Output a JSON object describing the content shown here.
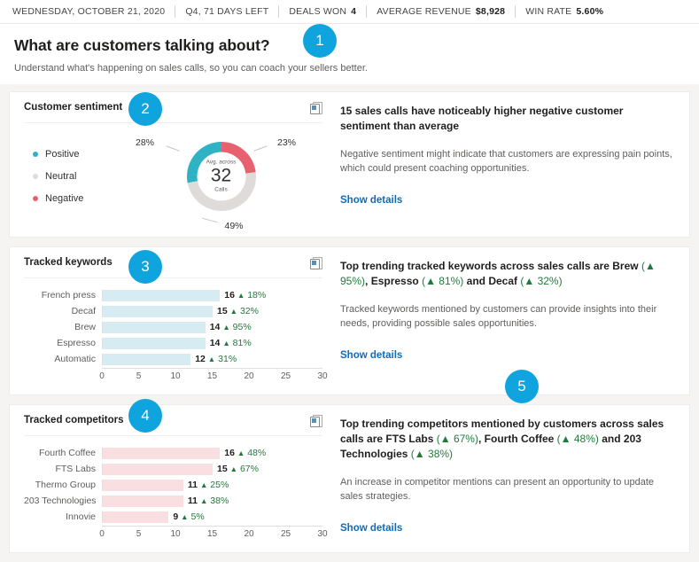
{
  "status_bar": {
    "items": [
      {
        "label": "WEDNESDAY, OCTOBER 21, 2020",
        "value": ""
      },
      {
        "label": "Q4, 71 DAYS LEFT",
        "value": ""
      },
      {
        "label": "DEALS WON",
        "value": "4"
      },
      {
        "label": "AVERAGE REVENUE",
        "value": "$8,928"
      },
      {
        "label": "WIN RATE",
        "value": "5.60%"
      }
    ]
  },
  "page": {
    "title": "What are customers talking about?",
    "subtitle": "Understand what's happening on sales calls, so you can coach your sellers better."
  },
  "colors": {
    "positive": "#2fb3c4",
    "neutral": "#dedbd9",
    "negative": "#e8616e",
    "keyword_bar": "#d7ecf2",
    "competitor_bar": "#fadfe2",
    "callout": "#0fa4de",
    "link": "#0f6cbd",
    "trend_up": "#217a3c"
  },
  "callouts": [
    {
      "number": "1"
    },
    {
      "number": "2"
    },
    {
      "number": "3"
    },
    {
      "number": "4"
    },
    {
      "number": "5"
    }
  ],
  "sentiment_card": {
    "title": "Customer sentiment",
    "copy_icon": "copy-icon",
    "legend": [
      {
        "label": "Positive",
        "color": "#2fb3c4"
      },
      {
        "label": "Neutral",
        "color": "#dedbd9"
      },
      {
        "label": "Negative",
        "color": "#e8616e"
      }
    ],
    "center_caption": "Avg. across",
    "center_value": "32",
    "center_unit": "Calls",
    "label_left": "28%",
    "label_right": "23%",
    "label_bottom": "49%",
    "insight_title_pre": "15 sales calls have noticeably higher negative customer sentiment than average",
    "insight_body": "Negative sentiment might indicate that customers are expressing pain points, which could present coaching opportunities.",
    "show_details": "Show details"
  },
  "keywords_card": {
    "title": "Tracked keywords",
    "copy_icon": "copy-icon",
    "insight_title_plain_1": "Top trending tracked keywords across sales calls are ",
    "insight_kw_1": "Brew",
    "insight_kw_1_pct": "95%",
    "insight_plain_2": ", ",
    "insight_kw_2": "Espresso",
    "insight_kw_2_pct": "81%",
    "insight_plain_3": " and ",
    "insight_kw_3": "Decaf",
    "insight_kw_3_pct": "32%",
    "insight_body": "Tracked keywords mentioned by customers can provide insights into their needs, providing possible sales opportunities.",
    "show_details": "Show details"
  },
  "competitors_card": {
    "title": "Tracked competitors",
    "copy_icon": "copy-icon",
    "insight_title_plain_1": "Top trending competitors mentioned by customers across sales calls are ",
    "insight_kw_1": "FTS Labs",
    "insight_kw_1_pct": "67%",
    "insight_plain_2": ", ",
    "insight_kw_2": "Fourth Coffee",
    "insight_kw_2_pct": "48%",
    "insight_plain_3": " and ",
    "insight_kw_3": "203 Technologies",
    "insight_kw_3_pct": "38%",
    "insight_body": "An increase in competitor mentions can present an opportunity to update sales strategies.",
    "show_details": "Show details"
  },
  "chart_data": [
    {
      "type": "pie",
      "title": "Customer sentiment",
      "labels": [
        "Positive",
        "Neutral",
        "Negative"
      ],
      "values": [
        28,
        49,
        23
      ],
      "value_labels": [
        "28%",
        "49%",
        "23%"
      ],
      "colors": [
        "#2fb3c4",
        "#dedbd9",
        "#e8616e"
      ],
      "center_text": "Avg. across 32 Calls",
      "legend_position": "left",
      "donut": true
    },
    {
      "type": "bar",
      "orientation": "horizontal",
      "title": "Tracked keywords",
      "categories": [
        "French press",
        "Decaf",
        "Brew",
        "Espresso",
        "Automatic"
      ],
      "values": [
        16,
        15,
        14,
        14,
        12
      ],
      "deltas": [
        "18%",
        "32%",
        "95%",
        "81%",
        "31%"
      ],
      "delta_direction": [
        "up",
        "up",
        "up",
        "up",
        "up"
      ],
      "xlabel": "",
      "ylabel": "",
      "xlim": [
        0,
        30
      ],
      "xticks": [
        0,
        5,
        10,
        15,
        20,
        25,
        30
      ],
      "grid": false,
      "bar_color": "#d7ecf2"
    },
    {
      "type": "bar",
      "orientation": "horizontal",
      "title": "Tracked competitors",
      "categories": [
        "Fourth Coffee",
        "FTS Labs",
        "Thermo Group",
        "203 Technologies",
        "Innovie"
      ],
      "values": [
        16,
        15,
        11,
        11,
        9
      ],
      "deltas": [
        "48%",
        "67%",
        "25%",
        "38%",
        "5%"
      ],
      "delta_direction": [
        "up",
        "up",
        "up",
        "up",
        "up"
      ],
      "xlabel": "",
      "ylabel": "",
      "xlim": [
        0,
        30
      ],
      "xticks": [
        0,
        5,
        10,
        15,
        20,
        25,
        30
      ],
      "grid": false,
      "bar_color": "#fadfe2"
    }
  ]
}
